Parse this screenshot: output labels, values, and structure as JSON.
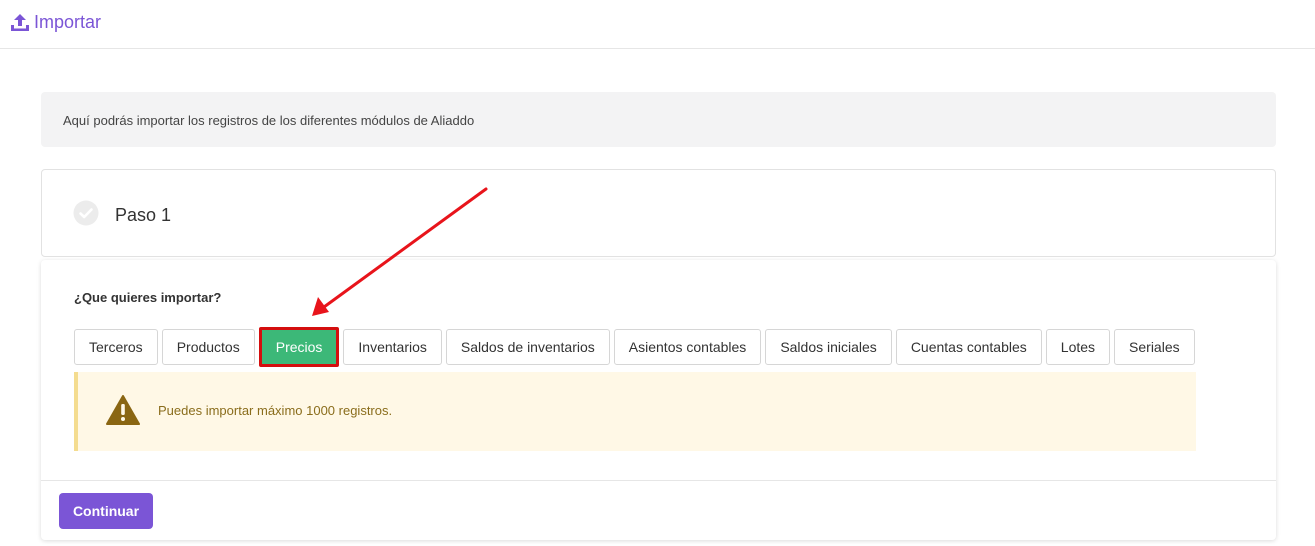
{
  "header": {
    "title": "Importar",
    "icon": "upload-icon"
  },
  "info": {
    "text": "Aquí podrás importar los registros de los diferentes módulos de Aliaddo"
  },
  "step": {
    "title": "Paso 1",
    "icon": "check-circle-icon"
  },
  "form": {
    "question": "¿Que quieres importar?",
    "options": [
      {
        "label": "Terceros"
      },
      {
        "label": "Productos"
      },
      {
        "label": "Precios"
      },
      {
        "label": "Inventarios"
      },
      {
        "label": "Saldos de inventarios"
      },
      {
        "label": "Asientos contables"
      },
      {
        "label": "Saldos iniciales"
      },
      {
        "label": "Cuentas contables"
      },
      {
        "label": "Lotes"
      },
      {
        "label": "Seriales"
      }
    ],
    "selected": "Precios"
  },
  "warning": {
    "text": "Puedes importar máximo 1000 registros.",
    "icon": "warning-icon"
  },
  "actions": {
    "continue_label": "Continuar"
  },
  "colors": {
    "accent": "#7b55d6",
    "selected": "#3cb878",
    "highlight": "#d40e0e",
    "warning_bg": "#fff8e6",
    "warning_text": "#8a6d1c"
  }
}
